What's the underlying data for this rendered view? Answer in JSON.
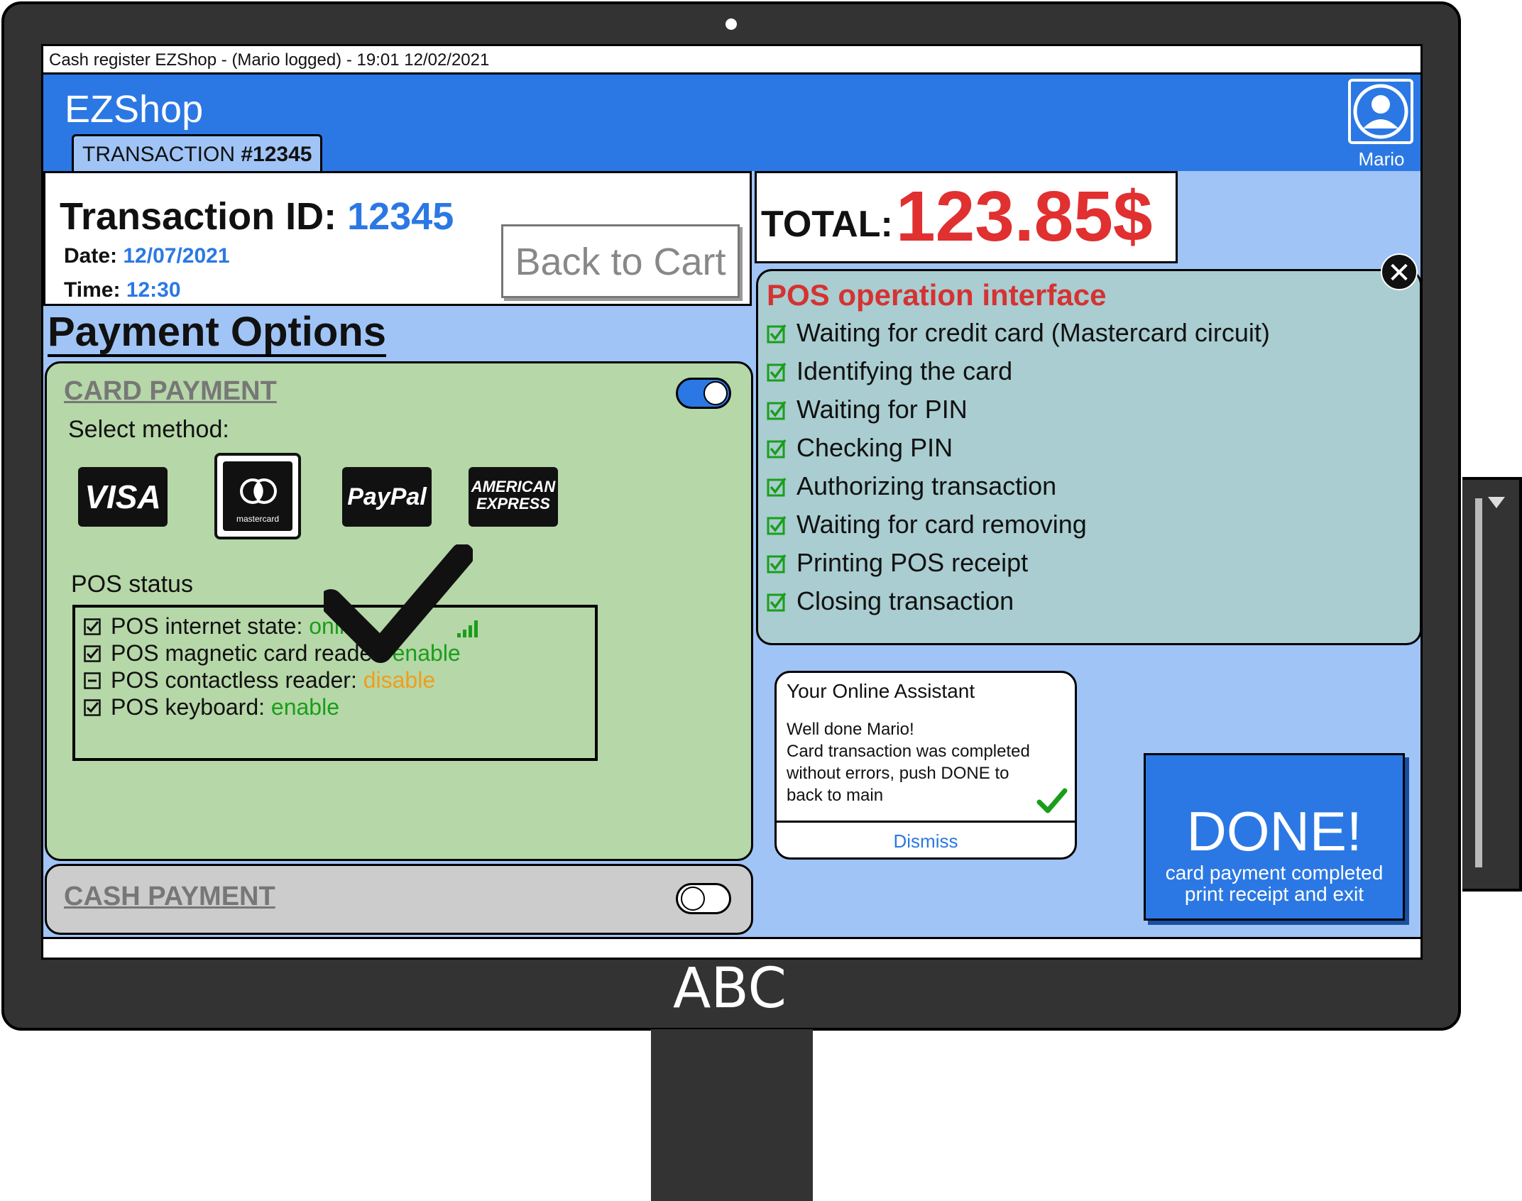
{
  "window": {
    "title": "Cash register EZShop - (Mario logged) - 19:01 12/02/2021"
  },
  "header": {
    "app_name": "EZShop",
    "tab_prefix": "TRANSACTION ",
    "tab_number": "#12345",
    "user_name": "Mario",
    "avatar_icon": "user-avatar-icon"
  },
  "transaction": {
    "id_label": "Transaction ID: ",
    "id_value": "12345",
    "date_label": "Date: ",
    "date_value": "12/07/2021",
    "time_label": "Time: ",
    "time_value": "12:30",
    "back_button": "Back to Cart"
  },
  "total": {
    "label": "TOTAL:",
    "value": "123.85$"
  },
  "payment": {
    "heading": "Payment Options",
    "card": {
      "title": "CARD PAYMENT",
      "enabled": true,
      "select_method": "Select method:",
      "methods": [
        "VISA",
        "mastercard",
        "PayPal",
        "AMERICAN EXPRESS"
      ],
      "selected_method": "mastercard",
      "pos_status_label": "POS status",
      "status_rows": [
        {
          "label": "POS internet state: ",
          "value": "online",
          "state": "checked",
          "color": "#1a9e1a"
        },
        {
          "label": "POS magnetic card reader: ",
          "value": "enable",
          "state": "checked",
          "color": "#1a9e1a"
        },
        {
          "label": "POS contactless reader: ",
          "value": "disable",
          "state": "partial",
          "color": "#f29d1b"
        },
        {
          "label": "POS keyboard: ",
          "value": "enable",
          "state": "checked",
          "color": "#1a9e1a"
        }
      ]
    },
    "cash": {
      "title": "CASH PAYMENT",
      "enabled": false
    }
  },
  "pos_interface": {
    "title": "POS operation interface",
    "steps": [
      "Waiting for credit card (Mastercard circuit)",
      "Identifying the card",
      "Waiting for PIN",
      "Checking PIN",
      "Authorizing transaction",
      "Waiting for card removing",
      "Printing POS receipt",
      "Closing transaction"
    ],
    "close_icon": "close-icon"
  },
  "assistant": {
    "title": "Your Online Assistant",
    "message": "Well done Mario!\nCard transaction was completed\nwithout errors, push DONE to\nback to main",
    "dismiss": "Dismiss"
  },
  "done_button": {
    "label": "DONE!",
    "sub1": "card payment completed",
    "sub2": "print receipt and exit"
  },
  "monitor": {
    "brand": "ABC"
  },
  "colors": {
    "header_blue": "#2b78e4",
    "screen_bg": "#a0c4f6",
    "card_panel": "#b6d7a8",
    "pos_panel": "#a9cdd0",
    "total_red": "#e03030",
    "pos_title_red": "#d53232"
  }
}
